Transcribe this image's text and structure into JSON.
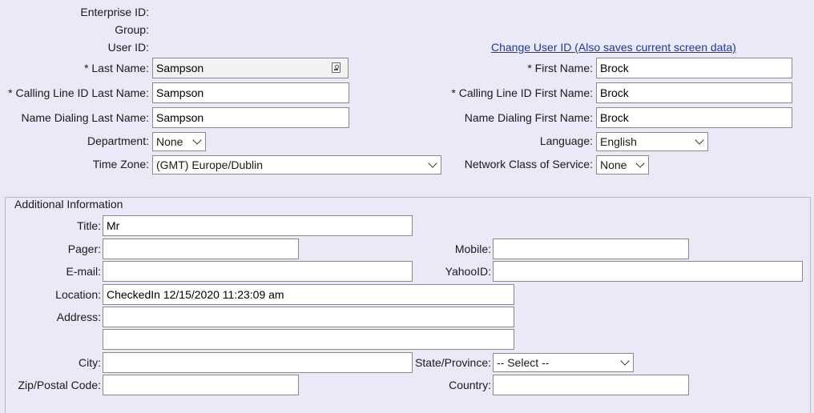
{
  "profile": {
    "enterprise_id_label": "Enterprise ID:",
    "group_label": "Group:",
    "user_id_label": "User ID:",
    "change_user_id_link": "Change User ID (Also saves current screen data)",
    "last_name_label": "* Last Name:",
    "last_name_value": "Sampson",
    "first_name_label": "* First Name:",
    "first_name_value": "Brock",
    "cl_last_name_label": "* Calling Line ID Last Name:",
    "cl_last_name_value": "Sampson",
    "cl_first_name_label": "* Calling Line ID First Name:",
    "cl_first_name_value": "Brock",
    "nd_last_name_label": "Name Dialing Last Name:",
    "nd_last_name_value": "Sampson",
    "nd_first_name_label": "Name Dialing First Name:",
    "nd_first_name_value": "Brock",
    "department_label": "Department:",
    "department_value": "None",
    "language_label": "Language:",
    "language_value": "English",
    "timezone_label": "Time Zone:",
    "timezone_value": "(GMT) Europe/Dublin",
    "ncos_label": "Network Class of Service:",
    "ncos_value": "None"
  },
  "additional": {
    "legend": "Additional Information",
    "title_label": "Title:",
    "title_value": "Mr",
    "pager_label": "Pager:",
    "pager_value": "",
    "mobile_label": "Mobile:",
    "mobile_value": "",
    "email_label": "E-mail:",
    "email_value": "",
    "yahoo_label": "YahooID:",
    "yahoo_value": "",
    "location_label": "Location:",
    "location_value": "CheckedIn 12/15/2020 11:23:09 am",
    "address_label": "Address:",
    "address_line1": "",
    "address_line2": "",
    "city_label": "City:",
    "city_value": "",
    "state_label": "State/Province:",
    "state_value": "-- Select --",
    "zip_label": "Zip/Postal Code:",
    "zip_value": "",
    "country_label": "Country:",
    "country_value": ""
  }
}
